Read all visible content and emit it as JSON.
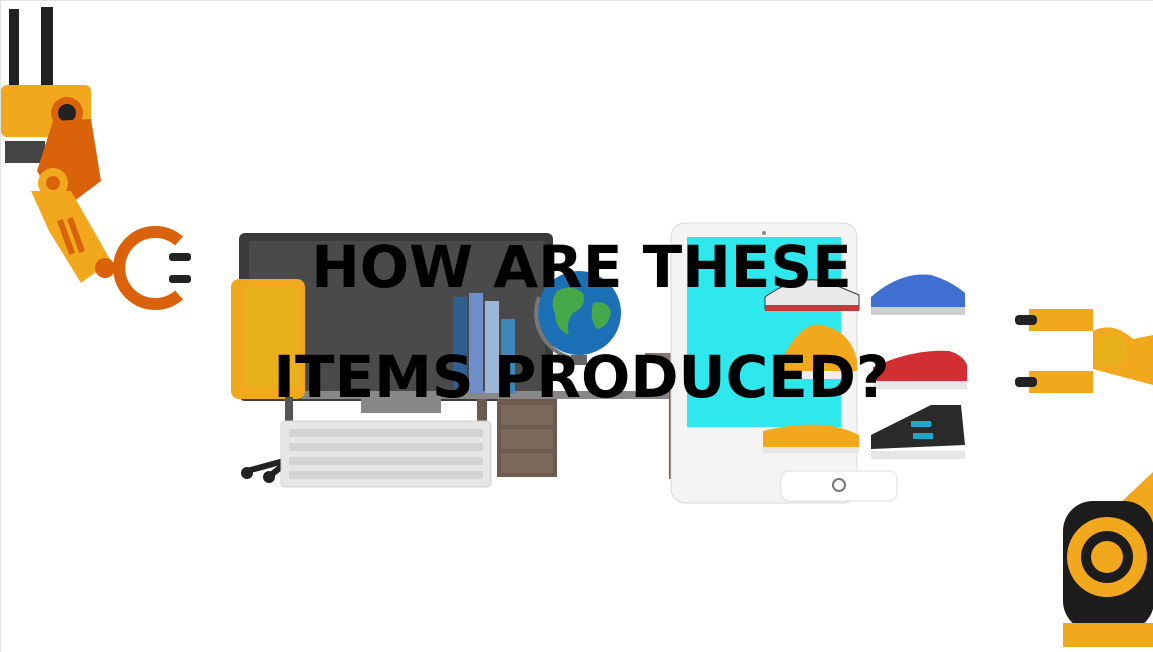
{
  "slide": {
    "title_line_1": "HOW ARE THESE",
    "title_line_2": "ITEMS PRODUCED?"
  },
  "illustration": {
    "icons": [
      "robot-arm-icon",
      "desk-chair-icon",
      "computer-monitor-icon",
      "keyboard-icon",
      "books-icon",
      "globe-icon",
      "filing-cabinet-icon",
      "tablet-icon",
      "shoe-icon"
    ]
  },
  "colors": {
    "robot_orange": "#f2a81d",
    "robot_dark_orange": "#d9620b",
    "tablet_cyan": "#2ee8ee",
    "monitor_dark": "#3b3b3b"
  }
}
